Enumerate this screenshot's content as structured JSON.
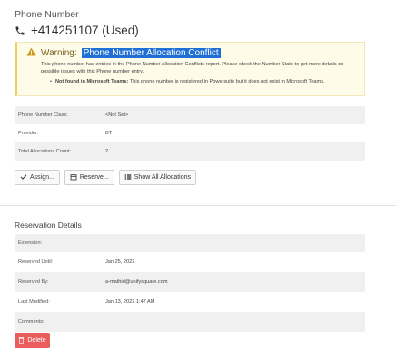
{
  "header": {
    "section_title": "Phone Number",
    "phone_number": "+414251107 (Used)"
  },
  "warning": {
    "label": "Warning:",
    "highlighted_title": "Phone Number Allocation Conflict",
    "message": "This phone number has entries in the Phone Number Allocation Conflicts report. Please check the Number State to get more details on possible issues with this Phone number entry.",
    "bullet_bold": "Not found in Microsoft Teams:",
    "bullet_text": "This phone number is registered in Powersuite but it does not exist in Microsoft Teams."
  },
  "details": [
    {
      "label": "Phone Number Class:",
      "value": "<Not Set>"
    },
    {
      "label": "Provider:",
      "value": "BT"
    },
    {
      "label": "Total Allocations Count:",
      "value": "2"
    }
  ],
  "actions": {
    "assign": "Assign...",
    "reserve": "Reserve...",
    "show_all": "Show All Allocations"
  },
  "reservation": {
    "title": "Reservation Details",
    "rows": [
      {
        "label": "Extension:",
        "value": ""
      },
      {
        "label": "Reserved Until:",
        "value": "Jan 25, 2022"
      },
      {
        "label": "Reserved By:",
        "value": "a-mathid@unifysquare.com"
      },
      {
        "label": "Last Modified:",
        "value": "Jan 13, 2022 1:47 AM"
      },
      {
        "label": "Comments:",
        "value": ""
      }
    ],
    "delete_label": "Delete"
  },
  "colors": {
    "warning_bg": "#fefbe9",
    "warning_accent": "#f0cf5a",
    "highlight": "#1f6fd6",
    "delete": "#ea5d5d"
  }
}
